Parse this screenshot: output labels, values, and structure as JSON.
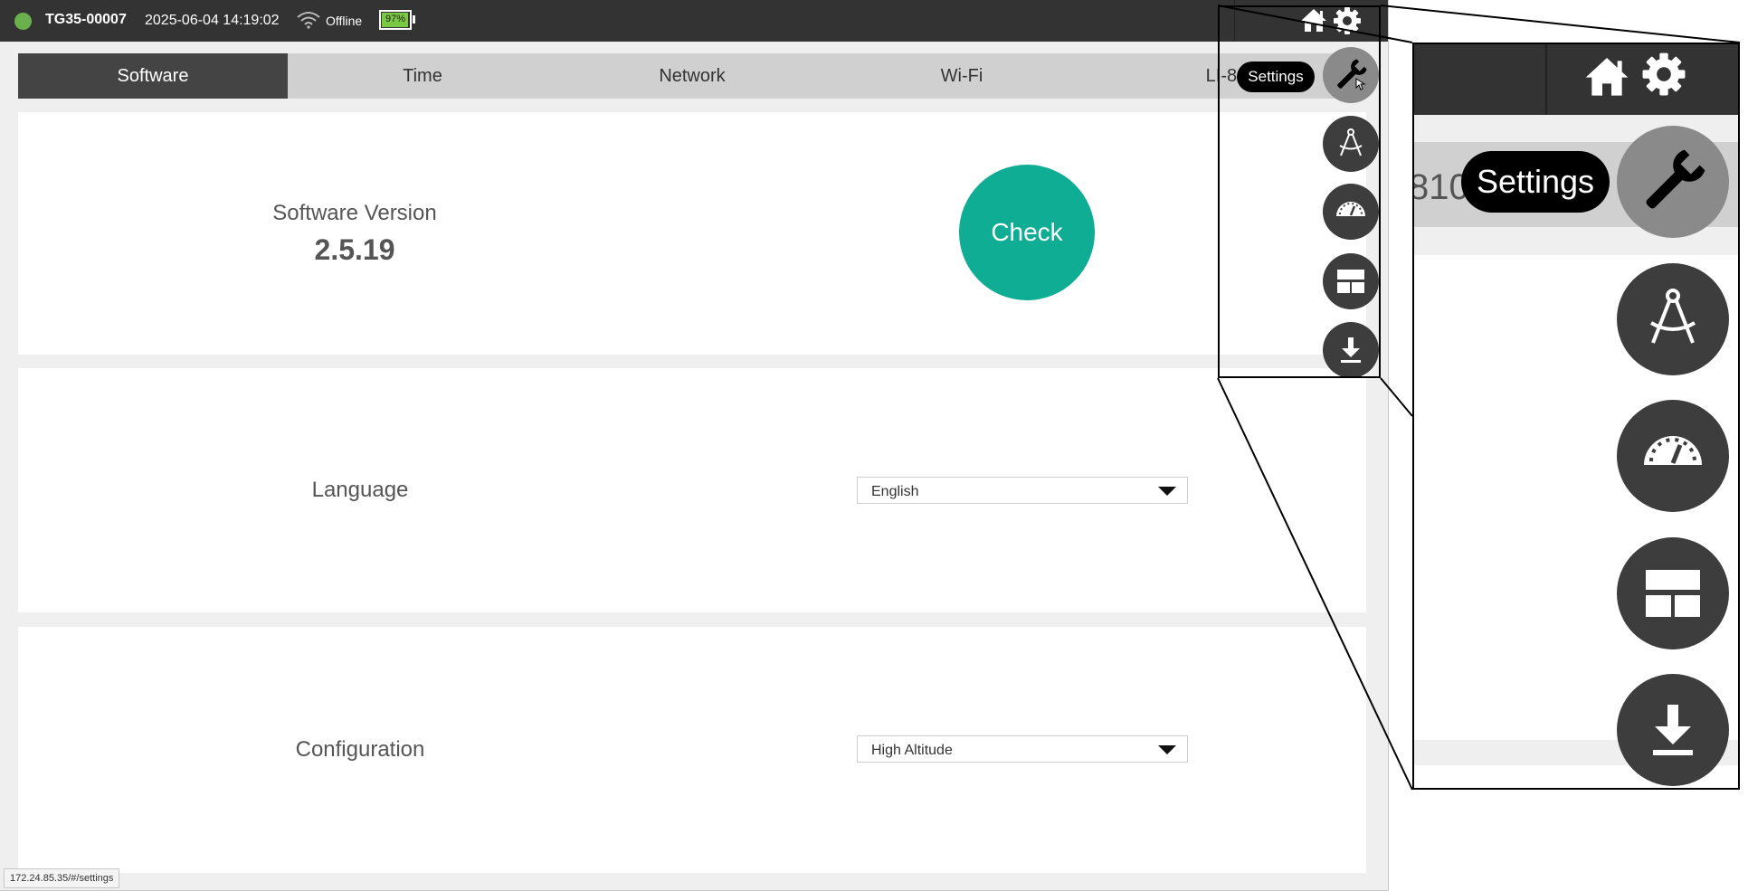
{
  "titlebar": {
    "device_id": "TG35-00007",
    "datetime": "2025-06-04 14:19:02",
    "connection_status": "Offline",
    "battery_percent": "97%",
    "battery_level": 0.97,
    "status_color": "#6ab04c"
  },
  "tabs": [
    {
      "label": "Software",
      "active": true
    },
    {
      "label": "Time",
      "active": false
    },
    {
      "label": "Network",
      "active": false
    },
    {
      "label": "Wi-Fi",
      "active": false
    },
    {
      "label": "LI-810",
      "active": false
    }
  ],
  "software": {
    "version_label": "Software Version",
    "version_value": "2.5.19",
    "check_label": "Check"
  },
  "language": {
    "label": "Language",
    "selected": "English"
  },
  "configuration": {
    "label": "Configuration",
    "selected": "High Altitude"
  },
  "side_menu": {
    "tooltip": "Settings",
    "items": [
      "wrench-icon",
      "compass-icon",
      "gauge-icon",
      "layout-icon",
      "download-icon"
    ]
  },
  "zoom": {
    "tab_fragment": "810",
    "tooltip": "Settings"
  },
  "status_url": "172.24.85.35/#/settings",
  "colors": {
    "accent": "#0fae94",
    "titlebar": "#333333",
    "fab": "#3d3d3d",
    "fab_hover": "#8a8a8a"
  }
}
